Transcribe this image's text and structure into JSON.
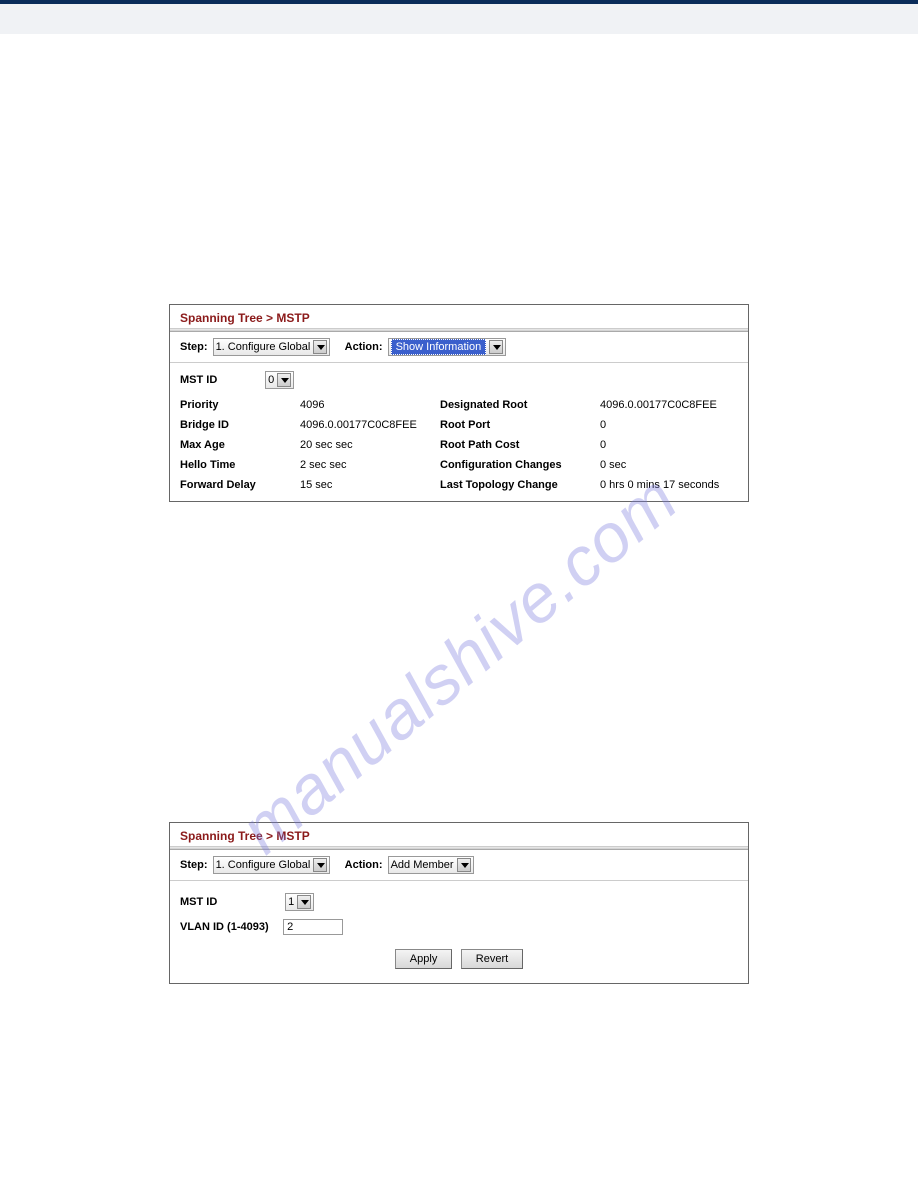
{
  "watermark": "manualshive.com",
  "panel1": {
    "title": "Spanning Tree > MSTP",
    "step_label": "Step:",
    "step_value": "1. Configure Global",
    "action_label": "Action:",
    "action_value": "Show Information",
    "mstid_label": "MST ID",
    "mstid_value": "0",
    "rows": {
      "priority_k": "Priority",
      "priority_v": "4096",
      "desroot_k": "Designated Root",
      "desroot_v": "4096.0.00177C0C8FEE",
      "bridge_k": "Bridge ID",
      "bridge_v": "4096.0.00177C0C8FEE",
      "rootport_k": "Root Port",
      "rootport_v": "0",
      "maxage_k": "Max Age",
      "maxage_v": "20 sec sec",
      "rootcost_k": "Root Path Cost",
      "rootcost_v": "0",
      "hello_k": "Hello Time",
      "hello_v": "2 sec sec",
      "cfgchg_k": "Configuration Changes",
      "cfgchg_v": "0 sec",
      "fwd_k": "Forward Delay",
      "fwd_v": "15 sec",
      "lasttop_k": "Last Topology Change",
      "lasttop_v": "0 hrs 0 mins 17 seconds"
    }
  },
  "panel2": {
    "title": "Spanning Tree > MSTP",
    "step_label": "Step:",
    "step_value": "1. Configure Global",
    "action_label": "Action:",
    "action_value": "Add Member",
    "mstid_label": "MST ID",
    "mstid_value": "1",
    "vlan_label": "VLAN ID (1-4093)",
    "vlan_value": "2",
    "apply": "Apply",
    "revert": "Revert"
  }
}
